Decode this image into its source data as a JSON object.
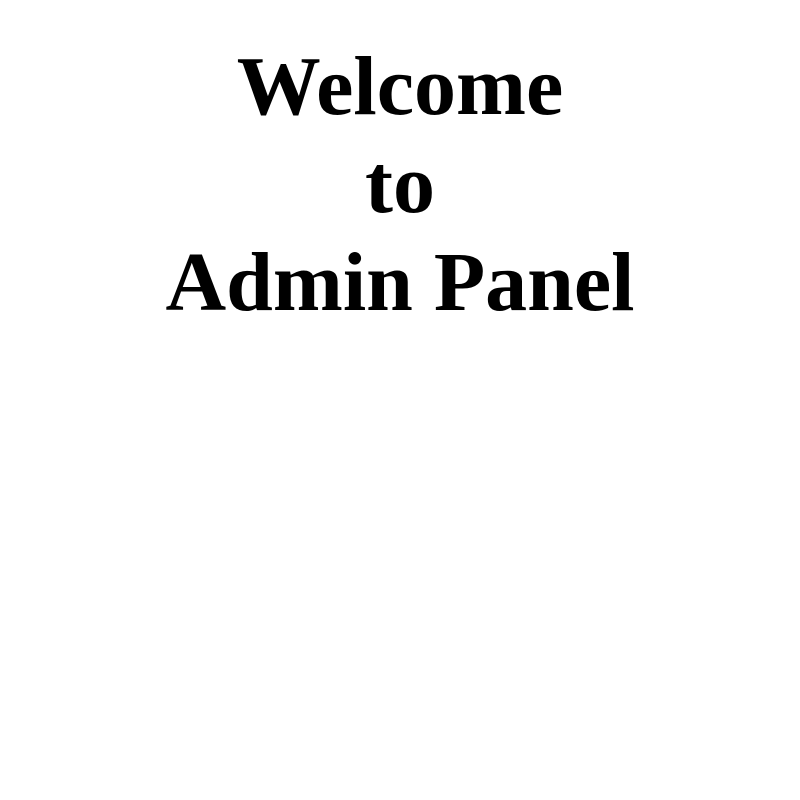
{
  "heading": {
    "lines": [
      "Welcome",
      "to",
      "Admin Panel"
    ],
    "color": "#000000"
  },
  "background_color": "#ffffff"
}
